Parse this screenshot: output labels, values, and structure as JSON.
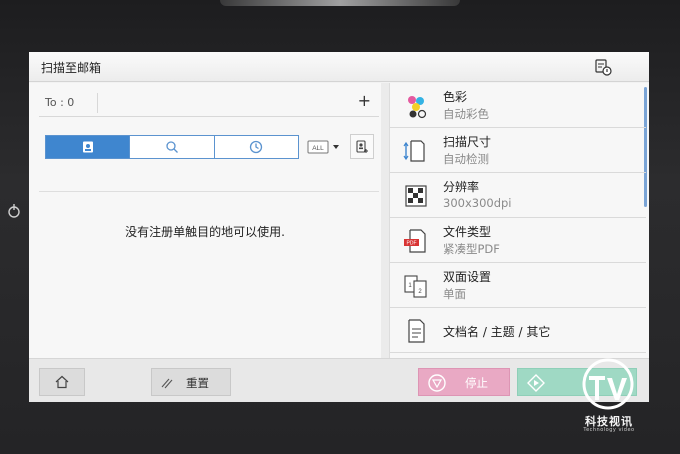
{
  "window": {
    "title": "扫描至邮箱"
  },
  "recipient": {
    "to_label": "To : 0",
    "add_symbol": "+"
  },
  "toolbar": {
    "all_label": "ALL"
  },
  "message": {
    "empty": "没有注册单触目的地可以使用."
  },
  "settings": [
    {
      "name": "色彩",
      "value": "自动彩色",
      "icon": "color-icon"
    },
    {
      "name": "扫描尺寸",
      "value": "自动检测",
      "icon": "scan-size-icon"
    },
    {
      "name": "分辨率",
      "value": "300x300dpi",
      "icon": "resolution-icon"
    },
    {
      "name": "文件类型",
      "value": "紧凑型PDF",
      "icon": "pdf-icon"
    },
    {
      "name": "双面设置",
      "value": "单面",
      "icon": "duplex-icon"
    },
    {
      "name": "文档名 / 主题 / 其它",
      "value": "",
      "icon": "document-icon"
    }
  ],
  "bottom": {
    "reset_label": "重置",
    "stop_label": "停止"
  },
  "watermark": {
    "brand": "科技视讯",
    "sub": "Technology video"
  },
  "colors": {
    "accent": "#3f86cf",
    "stop": "#e9a9c4",
    "start": "#9fd9c4"
  }
}
